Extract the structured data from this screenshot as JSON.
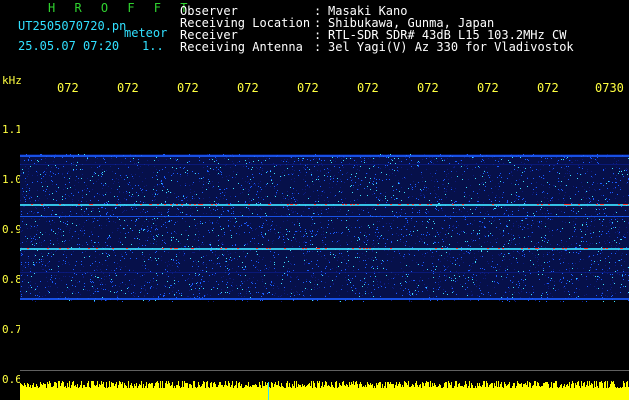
{
  "header": {
    "app_title": "H R O F F T",
    "filename_line": "UT2505070720.pn",
    "filename_suffix": "meteor",
    "datetime": "25.05.07 07:20",
    "datetime_extra": "1..",
    "fields": [
      {
        "label": "Observer",
        "sep": ":",
        "value": "Masaki Kano"
      },
      {
        "label": "Receiving Location",
        "sep": ":",
        "value": "Shibukawa, Gunma, Japan"
      },
      {
        "label": "Receiver",
        "sep": ":",
        "value": "RTL-SDR SDR# 43dB L15 103.2MHz CW"
      },
      {
        "label": "Receiving Antenna",
        "sep": ":",
        "value": "3el Yagi(V) Az 330 for Vladivostok"
      }
    ]
  },
  "axes": {
    "y_unit": "kHz",
    "y_ticks": [
      "1.1",
      "1.0",
      "0.9",
      "0.8",
      "0.7",
      "0.6"
    ],
    "x_ticks": [
      "072",
      "072",
      "072",
      "072",
      "072",
      "072",
      "072",
      "072",
      "072",
      "0730"
    ]
  },
  "colors": {
    "title": "#2fd22f",
    "file_info": "#31e0ff",
    "axis": "#ffff40",
    "signal_low": "#0b1a80",
    "signal_mid": "#1b5cff",
    "signal_high": "#3ee0ff",
    "hot": "#ff4030",
    "baseline": "#ffff00"
  }
}
